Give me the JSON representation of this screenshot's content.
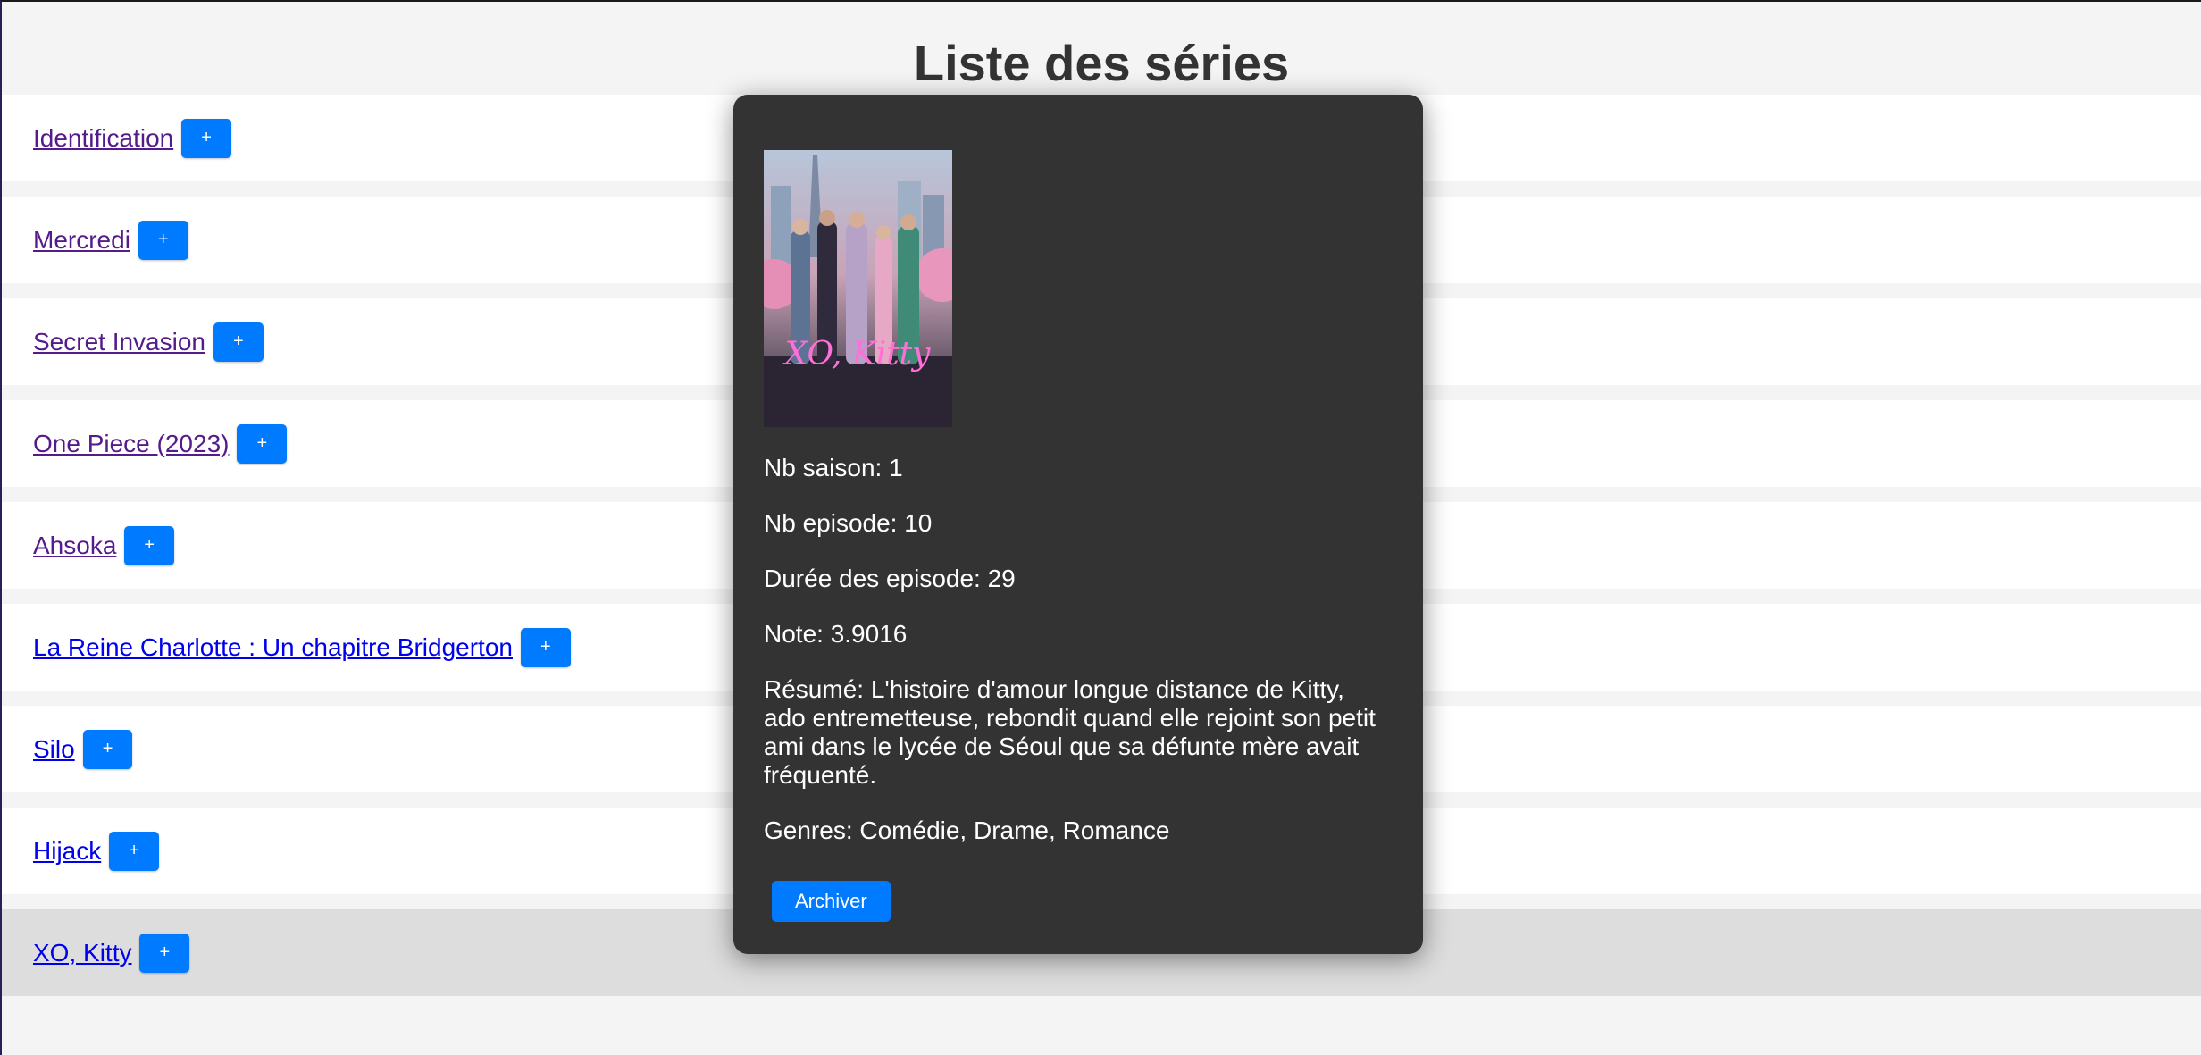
{
  "page": {
    "title": "Liste des séries"
  },
  "series": [
    {
      "title": "Identification",
      "add_label": "+",
      "visited": true
    },
    {
      "title": "Mercredi",
      "add_label": "+",
      "visited": true
    },
    {
      "title": "Secret Invasion",
      "add_label": "+",
      "visited": true
    },
    {
      "title": "One Piece (2023)",
      "add_label": "+",
      "visited": true
    },
    {
      "title": "Ahsoka",
      "add_label": "+",
      "visited": true
    },
    {
      "title": "La Reine Charlotte : Un chapitre Bridgerton",
      "add_label": "+",
      "visited": false
    },
    {
      "title": "Silo",
      "add_label": "+",
      "visited": false
    },
    {
      "title": "Hijack",
      "add_label": "+",
      "visited": false
    },
    {
      "title": "XO, Kitty",
      "add_label": "+",
      "visited": false,
      "active": true
    }
  ],
  "modal": {
    "poster_text": "XO, Kitty",
    "seasons": "Nb saison: 1",
    "episodes": "Nb episode: 10",
    "duration": "Durée des episode: 29",
    "rating": "Note: 3.9016",
    "summary": "Résumé: L'histoire d'amour longue distance de Kitty, ado entremetteuse, rebondit quand elle rejoint son petit ami dans le lycée de Séoul que sa défunte mère avait fréquenté.",
    "genres": "Genres: Comédie, Drame, Romance",
    "archive_label": "Archiver"
  }
}
